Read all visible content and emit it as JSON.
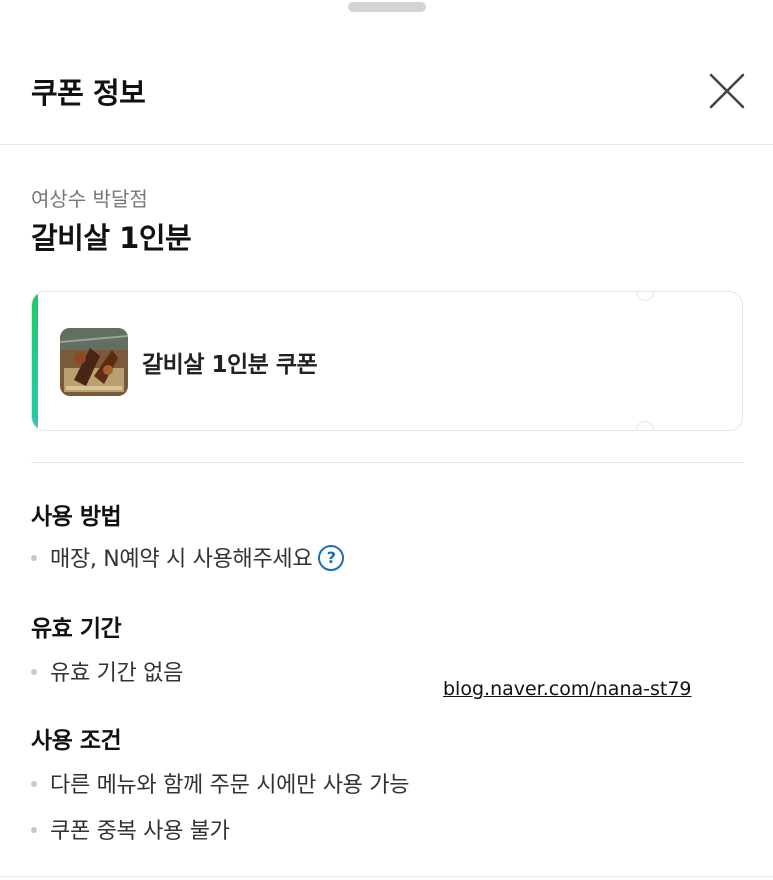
{
  "sheet": {
    "title": "쿠폰 정보"
  },
  "store": {
    "name": "여상수 박달점",
    "menu": "갈비살 1인분"
  },
  "coupon": {
    "label": "갈비살 1인분 쿠폰",
    "thumbnail_icon": "food-photo-icon",
    "accent_color": "#20c968"
  },
  "sections": {
    "usage": {
      "title": "사용 방법",
      "items": [
        "매장, N예약 시 사용해주세요"
      ],
      "help_icon": "question-circle-icon"
    },
    "validity": {
      "title": "유효 기간",
      "items": [
        "유효 기간 없음"
      ]
    },
    "conditions": {
      "title": "사용 조건",
      "items": [
        "다른 메뉴와 함께 주문 시에만 사용 가능",
        "쿠폰 중복 사용 불가"
      ]
    }
  },
  "watermark": "blog.naver.com/nana-st79"
}
